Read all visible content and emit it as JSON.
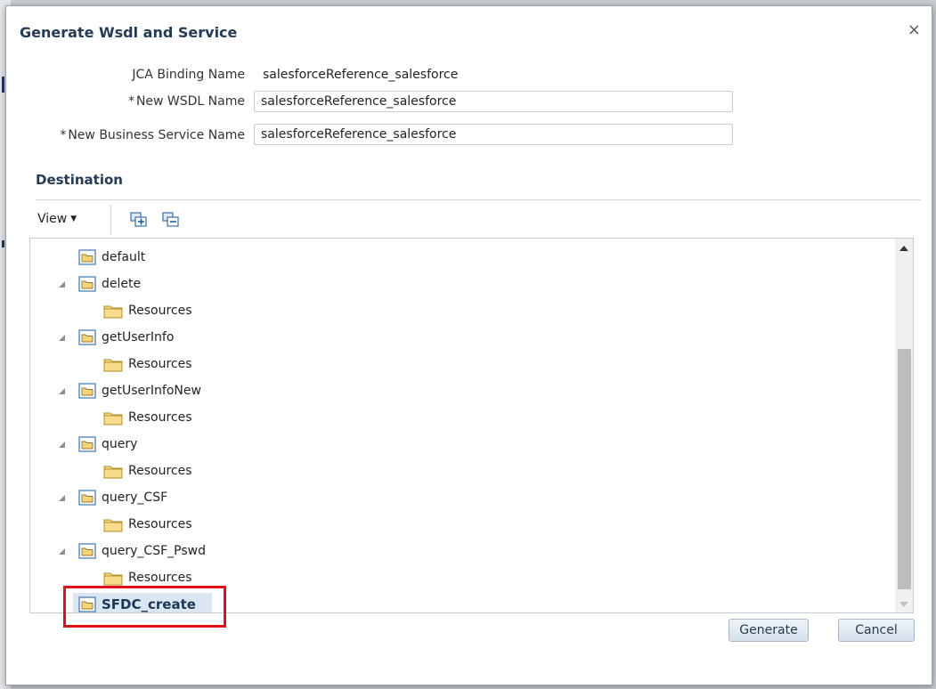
{
  "dialog": {
    "title": "Generate Wsdl and Service",
    "close_glyph": "×"
  },
  "form": {
    "jca_label": "JCA Binding Name",
    "jca_value": "salesforceReference_salesforce",
    "wsdl_label": "New WSDL Name",
    "wsdl_value": "salesforceReference_salesforce",
    "service_label": "New Business Service Name",
    "service_value": "salesforceReference_salesforce",
    "required_mark": "*"
  },
  "destination": {
    "title": "Destination",
    "view_label": "View",
    "toolbar_icons": [
      "expand-all-icon",
      "collapse-all-icon"
    ]
  },
  "tree": {
    "nodes": [
      {
        "label": "default",
        "expanded": false
      },
      {
        "label": "delete",
        "expanded": true
      },
      {
        "label": "Resources"
      },
      {
        "label": "getUserInfo",
        "expanded": true
      },
      {
        "label": "Resources"
      },
      {
        "label": "getUserInfoNew",
        "expanded": true
      },
      {
        "label": "Resources"
      },
      {
        "label": "query",
        "expanded": true
      },
      {
        "label": "Resources"
      },
      {
        "label": "query_CSF",
        "expanded": true
      },
      {
        "label": "Resources"
      },
      {
        "label": "query_CSF_Pswd",
        "expanded": true
      },
      {
        "label": "Resources"
      },
      {
        "label": "SFDC_create",
        "selected": true
      }
    ]
  },
  "buttons": {
    "generate": "Generate",
    "cancel": "Cancel"
  },
  "colors": {
    "accent": "#243a55",
    "highlight": "#e0101a",
    "folder": "#f3d47a"
  }
}
